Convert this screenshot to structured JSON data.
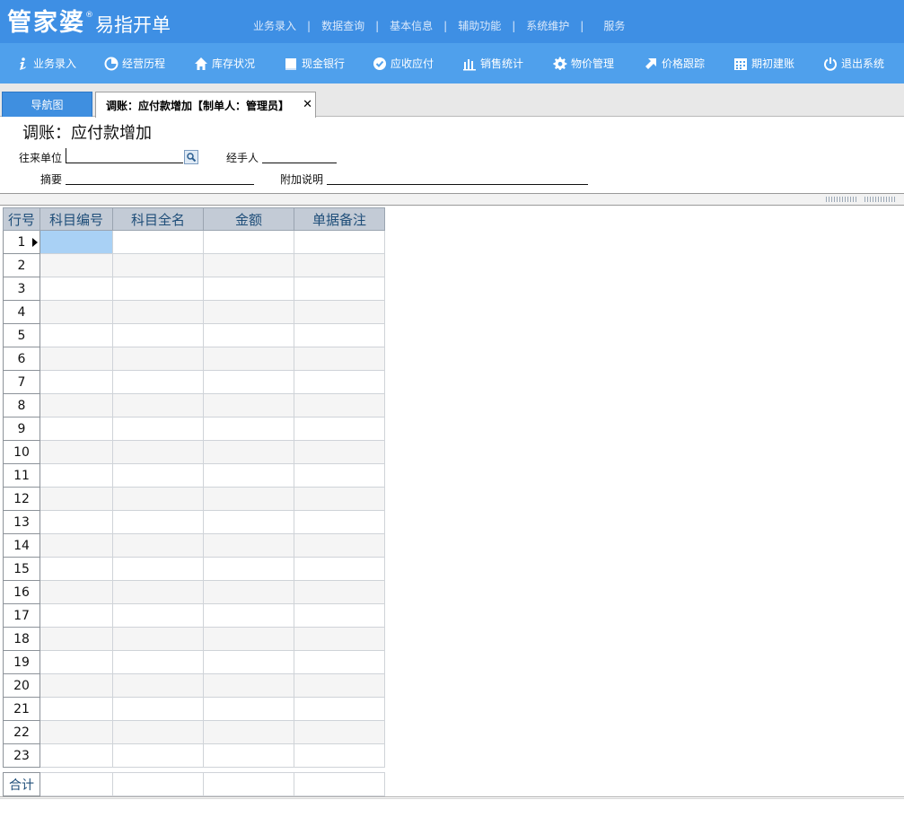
{
  "brand": {
    "name": "管家婆",
    "sub": "易指开单",
    "mark": "®"
  },
  "topnav": [
    {
      "label": "业务录入"
    },
    {
      "label": "数据查询"
    },
    {
      "label": "基本信息"
    },
    {
      "label": "辅助功能"
    },
    {
      "label": "系统维护"
    },
    {
      "label": "服务"
    }
  ],
  "toolbar": [
    {
      "label": "业务录入",
      "icon": "info-icon"
    },
    {
      "label": "经营历程",
      "icon": "pie-chart-icon"
    },
    {
      "label": "库存状况",
      "icon": "home-icon"
    },
    {
      "label": "现金银行",
      "icon": "book-icon"
    },
    {
      "label": "应收应付",
      "icon": "check-circle-icon"
    },
    {
      "label": "销售统计",
      "icon": "bar-chart-icon"
    },
    {
      "label": "物价管理",
      "icon": "gear-icon"
    },
    {
      "label": "价格跟踪",
      "icon": "arrow-up-right-icon"
    },
    {
      "label": "期初建账",
      "icon": "calendar-icon"
    },
    {
      "label": "退出系统",
      "icon": "power-icon"
    }
  ],
  "tabs": {
    "nav": "导航图",
    "active": "调账：应付款增加【制单人：管理员】",
    "close": "✕"
  },
  "form": {
    "title": "调账：应付款增加",
    "unit_label": "往来单位",
    "unit_value": "",
    "handler_label": "经手人",
    "handler_value": "",
    "summary_label": "摘要",
    "summary_value": "",
    "note_label": "附加说明",
    "note_value": ""
  },
  "grid": {
    "columns": [
      "行号",
      "科目编号",
      "科目全名",
      "金额",
      "单据备注"
    ],
    "rows": [
      "1",
      "2",
      "3",
      "4",
      "5",
      "6",
      "7",
      "8",
      "9",
      "10",
      "11",
      "12",
      "13",
      "14",
      "15",
      "16",
      "17",
      "18",
      "19",
      "20",
      "21",
      "22",
      "23"
    ],
    "total_label": "合计"
  },
  "colors": {
    "topbar": "#3e8fe4",
    "toolbar": "#4fa0ec",
    "selected_cell": "#a9d1f5",
    "header_text": "#1f4e79"
  }
}
